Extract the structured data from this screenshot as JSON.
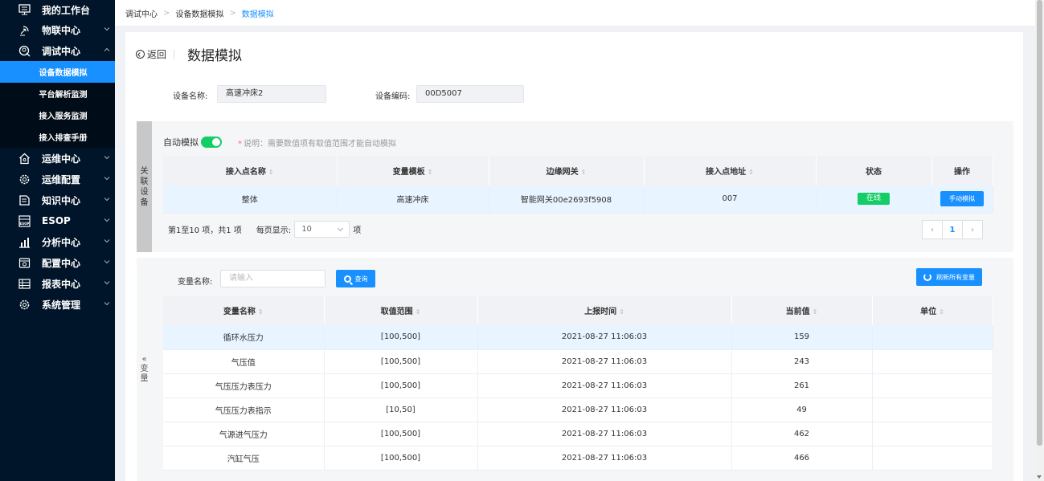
{
  "sidebar": {
    "items": [
      {
        "label": "我的工作台",
        "icon": "monitor-icon"
      },
      {
        "label": "物联中心",
        "icon": "antenna-icon"
      },
      {
        "label": "调试中心",
        "icon": "debug-icon"
      },
      {
        "label": "运维中心",
        "icon": "house-icon"
      },
      {
        "label": "运维配置",
        "icon": "gear-icon"
      },
      {
        "label": "知识中心",
        "icon": "book-icon"
      },
      {
        "label": "ESOP",
        "icon": "esop-icon"
      },
      {
        "label": "分析中心",
        "icon": "chart-icon"
      },
      {
        "label": "配置中心",
        "icon": "config-icon"
      },
      {
        "label": "报表中心",
        "icon": "report-icon"
      },
      {
        "label": "系统管理",
        "icon": "gear-icon"
      }
    ],
    "sub_items": [
      {
        "label": "设备数据模拟",
        "active": true
      },
      {
        "label": "平台解析监测",
        "active": false
      },
      {
        "label": "接入服务监测",
        "active": false
      },
      {
        "label": "接入排查手册",
        "active": false
      }
    ]
  },
  "breadcrumb": [
    "调试中心",
    "设备数据模拟",
    "数据模拟"
  ],
  "header": {
    "back_label": "返回",
    "title": "数据模拟"
  },
  "device_info": {
    "name_label": "设备名称:",
    "name_value": "高速冲床2",
    "code_label": "设备编码:",
    "code_value": "00D5007"
  },
  "related_section": {
    "tab_chars": [
      "关",
      "联",
      "设",
      "备"
    ],
    "auto_label": "自动模拟",
    "auto_enabled": true,
    "note_star": "*",
    "note": "说明：需要数值项有取值范围才能自动模拟",
    "columns": [
      "接入点名称",
      "变量模板",
      "边缘网关",
      "接入点地址",
      "状态",
      "操作"
    ],
    "rows": [
      {
        "name": "整体",
        "template": "高速冲床",
        "gateway": "智能网关00e2693f5908",
        "address": "007",
        "status": "在线",
        "action": "手动模拟"
      }
    ],
    "pager_info": "第1至10 项，共1 项",
    "page_size_label": "每页显示:",
    "page_size": "10",
    "page_unit": "项",
    "page_prev": "‹",
    "page_current": "1",
    "page_next": "›"
  },
  "variable_section": {
    "tab_chars": [
      "«",
      "变",
      "量"
    ],
    "search_label": "变量名称:",
    "search_placeholder": "请输入",
    "query_label": "查询",
    "refresh_label": "刷新所有变量",
    "columns": [
      "变量名称",
      "取值范围",
      "上报时间",
      "当前值",
      "单位"
    ],
    "rows": [
      {
        "name": "循环水压力",
        "range": "[100,500]",
        "time": "2021-08-27 11:06:03",
        "value": "159",
        "unit": ""
      },
      {
        "name": "气压值",
        "range": "[100,500]",
        "time": "2021-08-27 11:06:03",
        "value": "243",
        "unit": ""
      },
      {
        "name": "气压压力表压力",
        "range": "[100,500]",
        "time": "2021-08-27 11:06:03",
        "value": "261",
        "unit": ""
      },
      {
        "name": "气压压力表指示",
        "range": "[10,50]",
        "time": "2021-08-27 11:06:03",
        "value": "49",
        "unit": ""
      },
      {
        "name": "气源进气压力",
        "range": "[100,500]",
        "time": "2021-08-27 11:06:03",
        "value": "462",
        "unit": ""
      },
      {
        "name": "汽缸气压",
        "range": "[100,500]",
        "time": "2021-08-27 11:06:03",
        "value": "466",
        "unit": ""
      }
    ]
  },
  "colors": {
    "sidebar_bg": "#001529",
    "accent": "#1890ff",
    "online": "#13ce66"
  }
}
